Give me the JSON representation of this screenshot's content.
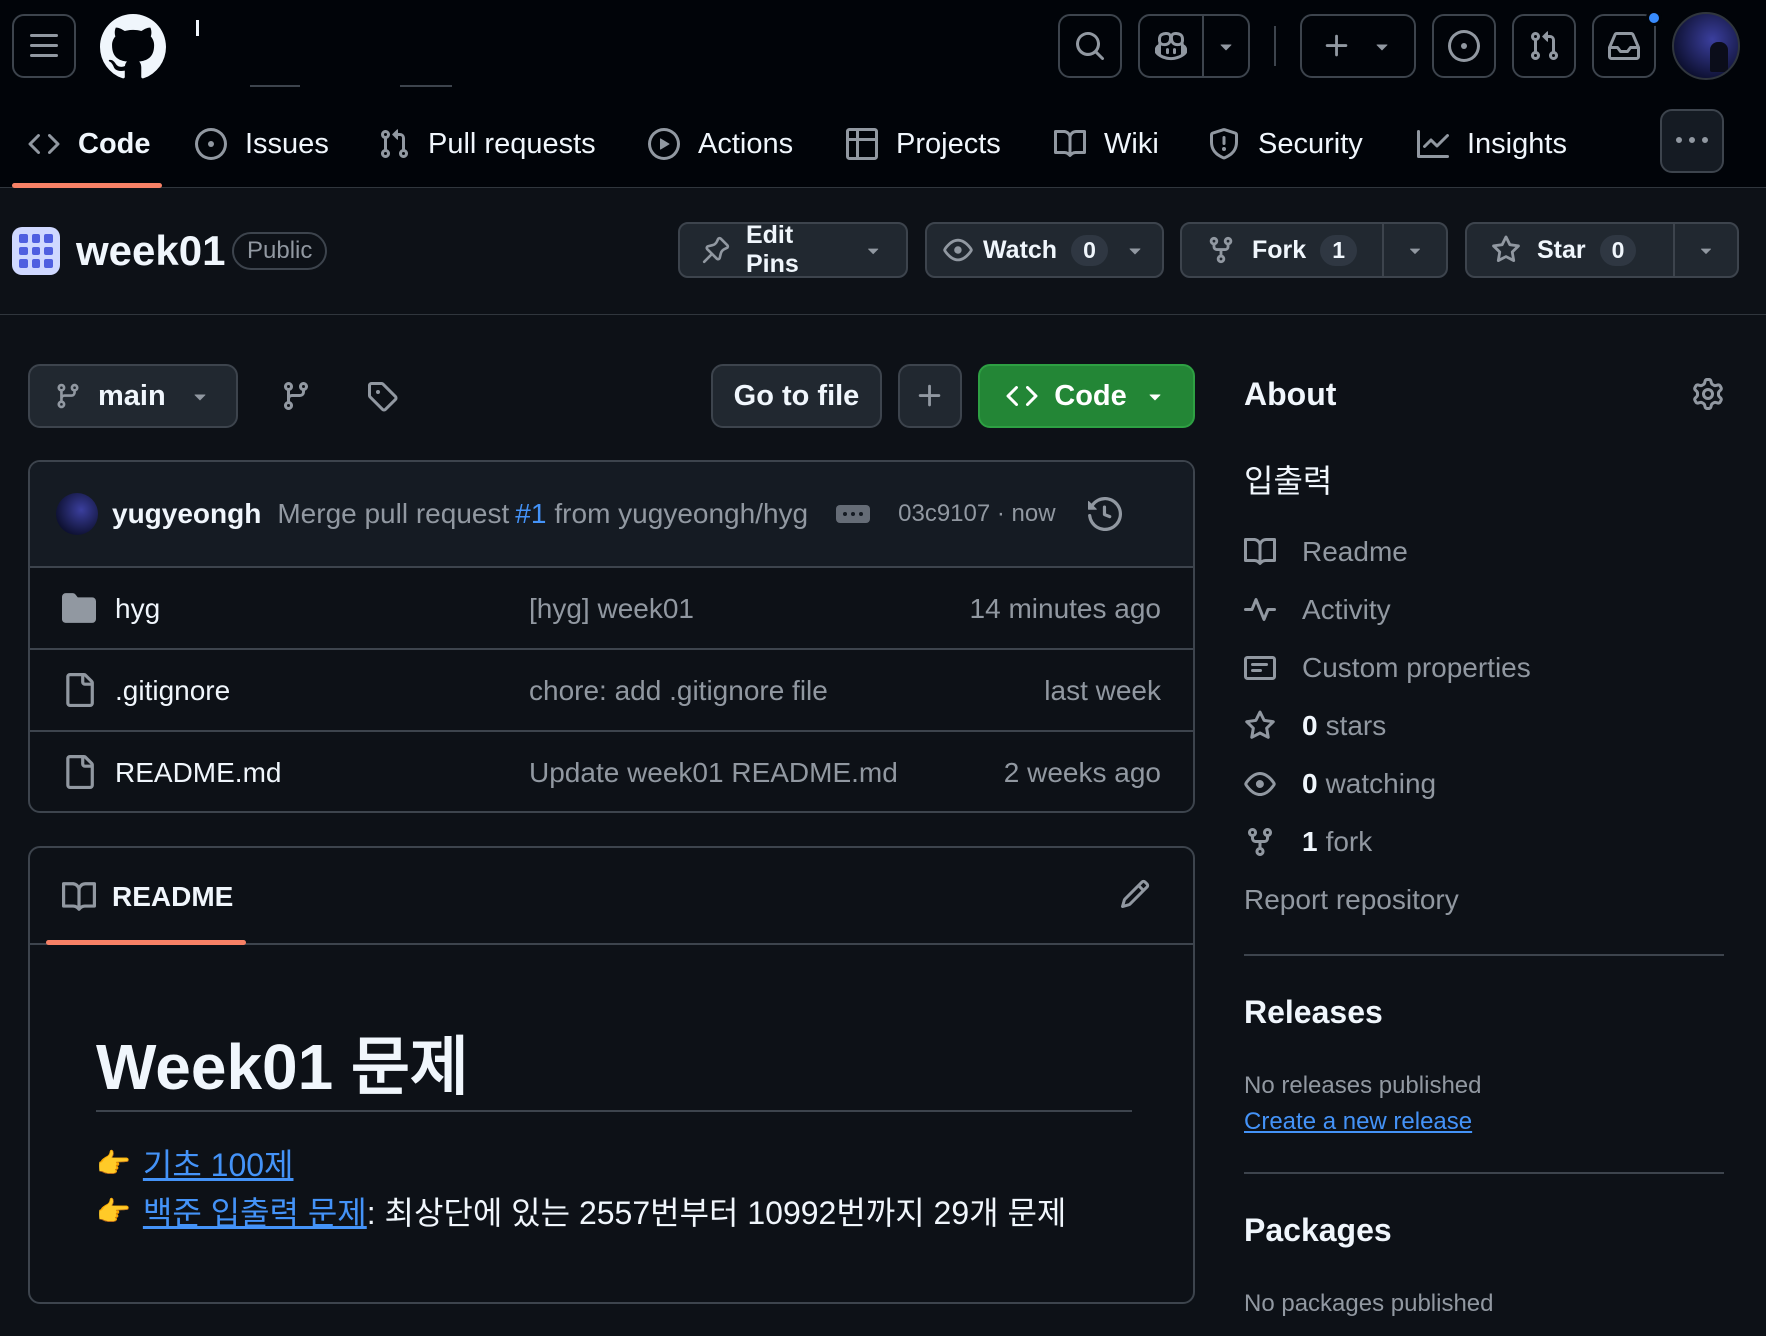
{
  "header": {
    "menu_icon": "hamburger-icon",
    "logo_icon": "github-mark-icon",
    "search_icon": "search-icon",
    "copilot_icon": "copilot-icon",
    "create_icon": "plus-icon",
    "issues_icon": "issue-opened-icon",
    "pulls_icon": "git-pull-request-icon",
    "inbox_icon": "inbox-icon",
    "inbox_unread": true
  },
  "nav": {
    "tabs": [
      {
        "label": "Code",
        "icon": "code-icon",
        "active": true
      },
      {
        "label": "Issues",
        "icon": "issue-opened-icon"
      },
      {
        "label": "Pull requests",
        "icon": "git-pull-request-icon"
      },
      {
        "label": "Actions",
        "icon": "play-icon"
      },
      {
        "label": "Projects",
        "icon": "table-icon"
      },
      {
        "label": "Wiki",
        "icon": "book-icon"
      },
      {
        "label": "Security",
        "icon": "shield-icon"
      },
      {
        "label": "Insights",
        "icon": "graph-icon"
      }
    ]
  },
  "repo": {
    "name": "week01",
    "visibility": "Public",
    "edit_pins": "Edit Pins",
    "watch_label": "Watch",
    "watch_count": "0",
    "fork_label": "Fork",
    "fork_count": "1",
    "star_label": "Star",
    "star_count": "0"
  },
  "toolbar": {
    "branch": "main",
    "go_to_file": "Go to file",
    "code_label": "Code"
  },
  "commit": {
    "author": "yugyeongh",
    "message": "Merge pull request",
    "pr_link": "#1",
    "from": "from yugyeongh/hyg",
    "hash_time": "03c9107 · now"
  },
  "files": [
    {
      "name": "hyg",
      "type": "folder",
      "message": "[hyg] week01",
      "date": "14 minutes ago"
    },
    {
      "name": ".gitignore",
      "type": "file",
      "message": "chore: add .gitignore file",
      "date": "last week"
    },
    {
      "name": "README.md",
      "type": "file",
      "message": "Update week01 README.md",
      "date": "2 weeks ago"
    }
  ],
  "readme": {
    "tab_label": "README",
    "heading": "Week01 문제",
    "line1_emoji": "👉",
    "line1_link": "기초 100제",
    "line2_emoji": "👉",
    "line2_link": "백준 입출력 문제",
    "line2_rest": ": 최상단에 있는 2557번부터 10992번까지 29개 문제"
  },
  "sidebar": {
    "about_title": "About",
    "description": "입출력",
    "links": [
      {
        "label": "Readme",
        "icon": "book-icon"
      },
      {
        "label": "Activity",
        "icon": "pulse-icon"
      },
      {
        "label": "Custom properties",
        "icon": "note-icon"
      }
    ],
    "stars_count": "0",
    "stars_label": "stars",
    "watching_count": "0",
    "watching_label": "watching",
    "forks_count": "1",
    "forks_label": "fork",
    "report": "Report repository",
    "releases_title": "Releases",
    "releases_empty": "No releases published",
    "releases_link": "Create a new release",
    "packages_title": "Packages",
    "packages_empty": "No packages published"
  },
  "colors": {
    "bg": "#0d1117",
    "header_bg": "#010409",
    "accent_underline": "#f78166",
    "primary_button": "#238636",
    "link": "#4493f8",
    "notification_dot": "#388bfd"
  }
}
